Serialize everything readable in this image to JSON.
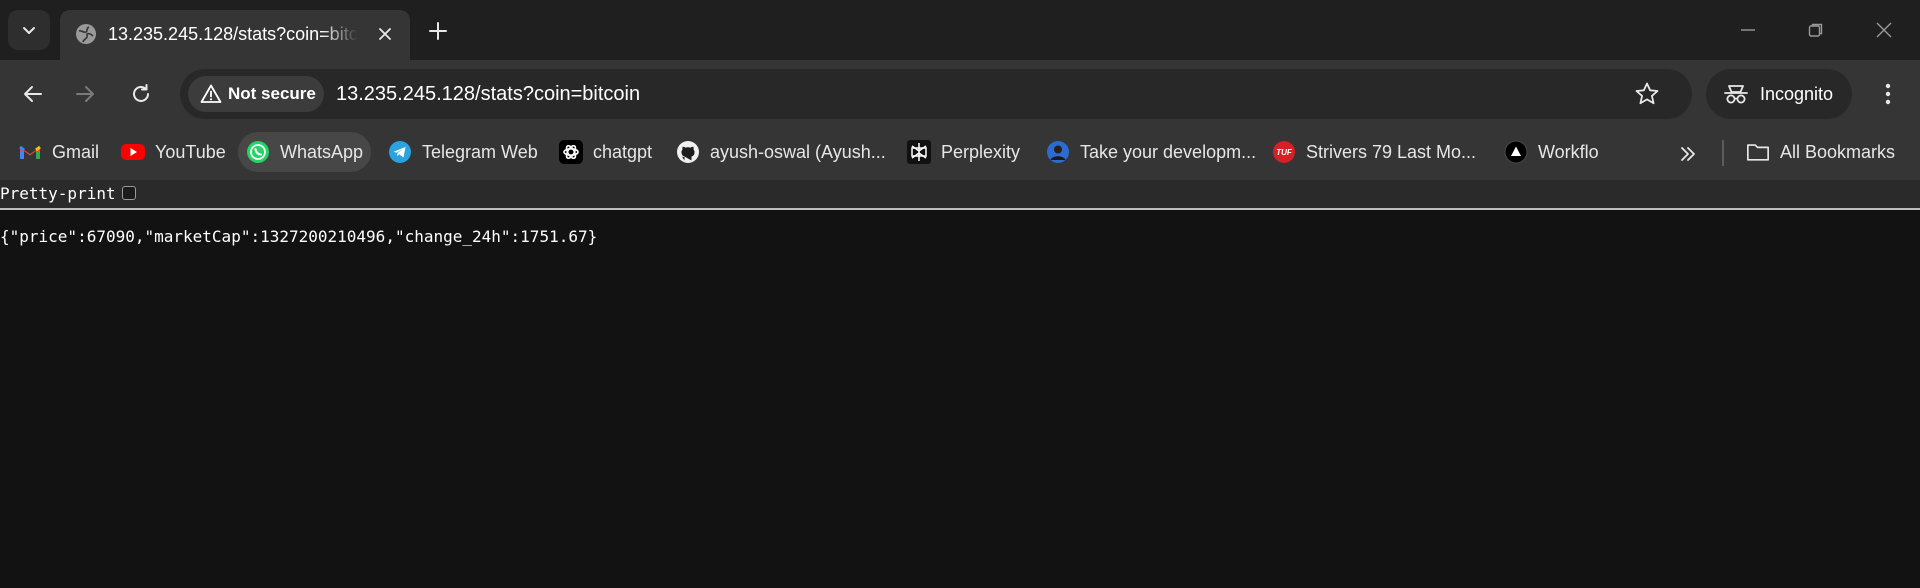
{
  "tab": {
    "title": "13.235.245.128/stats?coin=bitcoin",
    "favicon": "globe-icon"
  },
  "toolbar": {
    "security_label": "Not secure",
    "url": "13.235.245.128/stats?coin=bitcoin",
    "profile_label": "Incognito"
  },
  "bookmarks": {
    "items": [
      {
        "label": "Gmail",
        "icon": "gmail-icon"
      },
      {
        "label": "YouTube",
        "icon": "youtube-icon"
      },
      {
        "label": "WhatsApp",
        "icon": "whatsapp-icon"
      },
      {
        "label": "Telegram Web",
        "icon": "telegram-icon"
      },
      {
        "label": "chatgpt",
        "icon": "chatgpt-icon"
      },
      {
        "label": "ayush-oswal (Ayush...",
        "icon": "github-icon"
      },
      {
        "label": "Perplexity",
        "icon": "perplexity-icon"
      },
      {
        "label": "Take your developm...",
        "icon": "avatar-icon"
      },
      {
        "label": "Strivers 79 Last Mo...",
        "icon": "tuf-icon"
      },
      {
        "label": "Workflo",
        "icon": "workflo-icon"
      }
    ],
    "all_bookmarks_label": "All Bookmarks"
  },
  "page": {
    "pretty_print_label": "Pretty-print",
    "pretty_print_checked": false,
    "json_text": "{\"price\":67090,\"marketCap\":1327200210496,\"change_24h\":1751.67}"
  },
  "colors": {
    "tabstrip": "#1f1f1f",
    "toolbar": "#353535",
    "omnibox": "#282828",
    "page_bg": "#121212"
  }
}
